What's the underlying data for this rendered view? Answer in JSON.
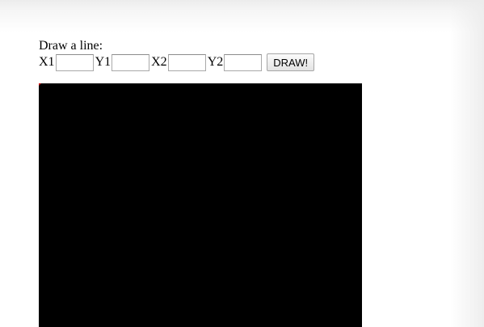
{
  "form": {
    "title": "Draw a line:",
    "labels": {
      "x1": "X1",
      "y1": "Y1",
      "x2": "X2",
      "y2": "Y2"
    },
    "values": {
      "x1": "",
      "y1": "",
      "x2": "",
      "y2": ""
    },
    "button_label": "DRAW!"
  },
  "canvas": {
    "background": "#000000",
    "marker_color": "#cc0000"
  },
  "colors": {
    "page_background": "#ffffff",
    "top_band": "#ececec"
  }
}
